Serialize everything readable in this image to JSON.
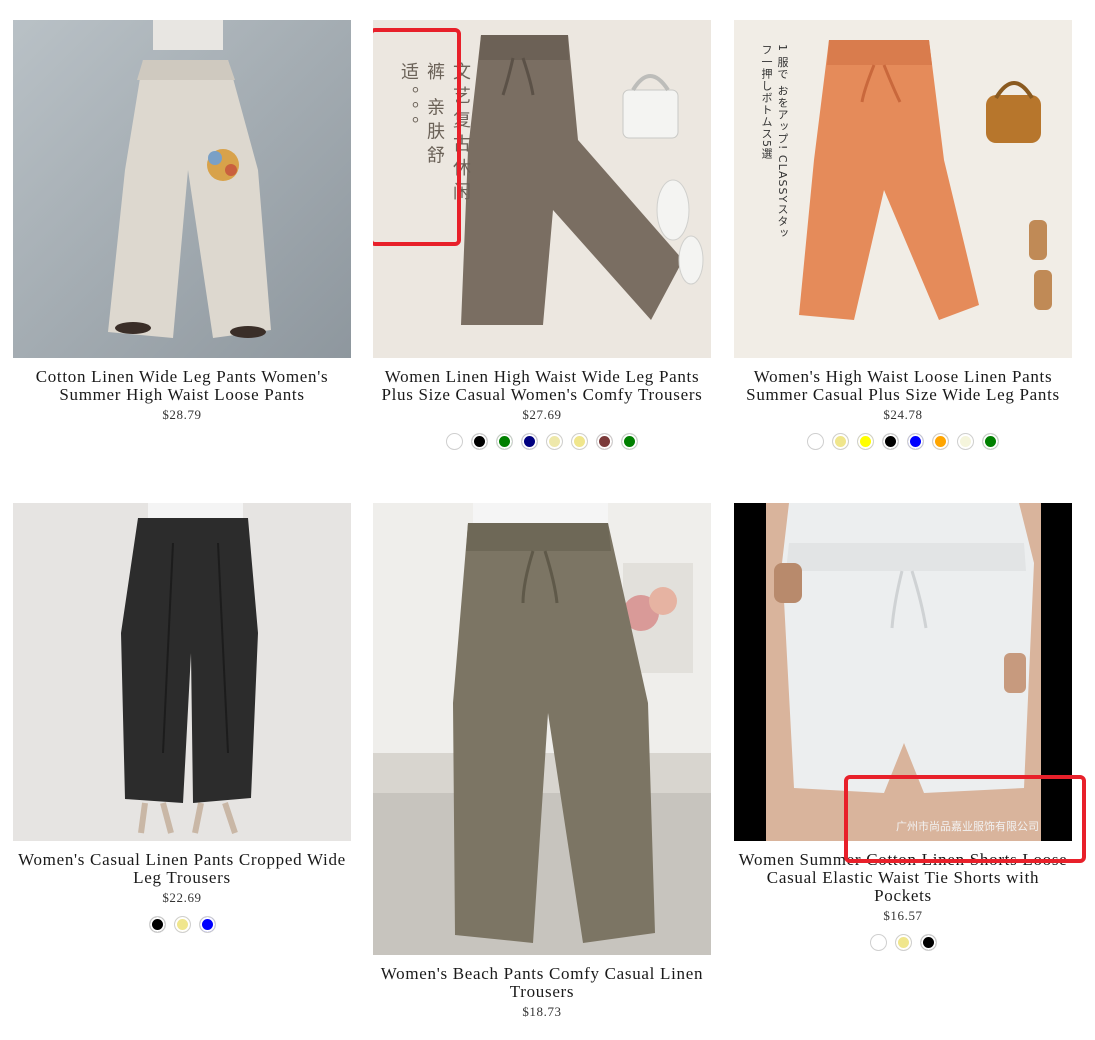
{
  "products": [
    {
      "title": "Cotton Linen Wide Leg Pants Women's Summer High Waist Loose Pants",
      "price": "$28.79",
      "swatches": []
    },
    {
      "title": "Women Linen High Waist Wide Leg Pants Plus Size Casual Women's Comfy Trousers",
      "price": "$27.69",
      "overlay_text": "文艺复古休闲裤 亲肤舒适。。。",
      "swatches": [
        "#ffffff",
        "#000000",
        "#008000",
        "#000080",
        "#eee8aa",
        "#f0e68c",
        "#7b3a3a",
        "#008000"
      ]
    },
    {
      "title": "Women's High Waist Loose Linen Pants Summer Casual Plus Size Wide Leg Pants",
      "price": "$24.78",
      "overlay_text": "1 服で おをアップ! CLASSYスタッフ一押しボトムス5選",
      "swatches": [
        "#ffffff",
        "#f0e68c",
        "#ffff00",
        "#000000",
        "#0000ff",
        "#ffa500",
        "#f5f5dc",
        "#008000"
      ]
    },
    {
      "title": "Women's Casual Linen Pants Cropped Wide Leg Trousers",
      "price": "$22.69",
      "swatches": [
        "#000000",
        "#f0e68c",
        "#0000ff"
      ]
    },
    {
      "title": "Women's Beach Pants Comfy Casual Linen Trousers",
      "price": "$18.73",
      "swatches": []
    },
    {
      "title": "Women Summer Cotton Linen Shorts Loose Casual Elastic Waist Tie Shorts with Pockets",
      "price": "$16.57",
      "overlay_text": "广州市尚品嘉业服饰有限公司",
      "swatches": [
        "#ffffff",
        "#f0e68c",
        "#000000"
      ]
    }
  ]
}
